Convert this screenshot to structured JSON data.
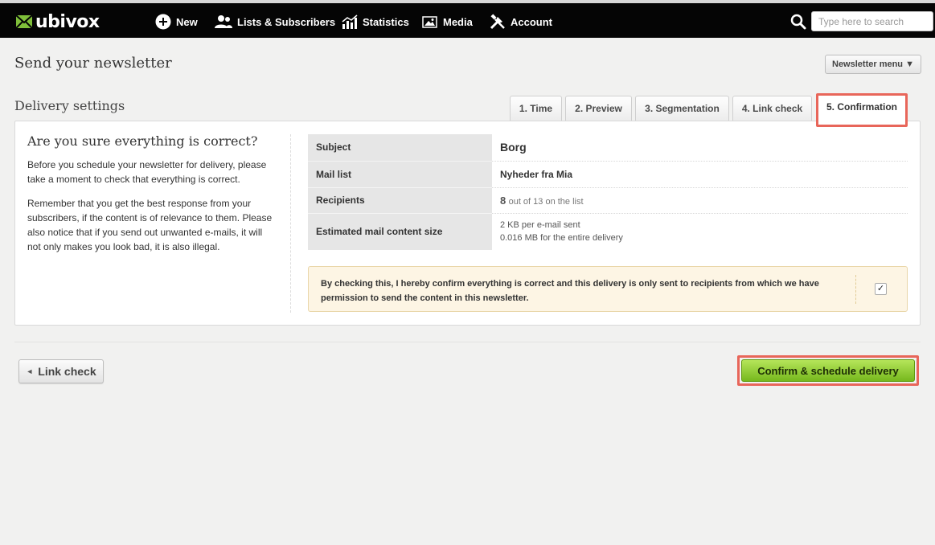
{
  "app": {
    "logo_text": "ubivox"
  },
  "nav": {
    "items": [
      {
        "label": "New",
        "icon": "plus-circle-icon"
      },
      {
        "label": "Lists & Subscribers",
        "icon": "users-icon"
      },
      {
        "label": "Statistics",
        "icon": "bar-chart-icon"
      },
      {
        "label": "Media",
        "icon": "image-icon"
      },
      {
        "label": "Account",
        "icon": "tools-icon"
      }
    ],
    "search_placeholder": "Type here to search"
  },
  "page": {
    "title": "Send your newsletter",
    "menu_label": "Newsletter menu ▼",
    "section_title": "Delivery settings"
  },
  "tabs": [
    {
      "label": "1. Time"
    },
    {
      "label": "2. Preview"
    },
    {
      "label": "3. Segmentation"
    },
    {
      "label": "4. Link check"
    },
    {
      "label": "5. Confirmation",
      "active": true
    }
  ],
  "left": {
    "heading": "Are you sure everything is correct?",
    "paragraph1": "Before you schedule your newsletter for delivery, please take a moment to check that everything is correct.",
    "paragraph2": "Remember that you get the best response from your subscribers, if the content is of relevance to them. Please also notice that if you send out unwanted e-mails, it will not only makes you look bad, it is also illegal."
  },
  "summary": {
    "subject_label": "Subject",
    "subject_value": "Borg",
    "maillist_label": "Mail list",
    "maillist_value": "Nyheder fra Mia",
    "recipients_label": "Recipients",
    "recipients_count": "8",
    "recipients_suffix": "out of 13 on the list",
    "size_label": "Estimated mail content size",
    "size_line1": "2 KB per e-mail sent",
    "size_line2": "0.016 MB for the entire delivery"
  },
  "confirm": {
    "text": "By checking this, I hereby confirm everything is correct and this delivery is only sent to recipients from which we have permission to send the content in this newsletter.",
    "checked": true,
    "check_mark": "✓"
  },
  "actions": {
    "back_label": "Link check",
    "back_arrow": "◄",
    "confirm_label": "Confirm & schedule delivery"
  },
  "colors": {
    "topbar": "#050505",
    "highlight": "#e8665a",
    "confirm_green": "#8cc63f",
    "warning_bg": "#fdf5e4"
  }
}
